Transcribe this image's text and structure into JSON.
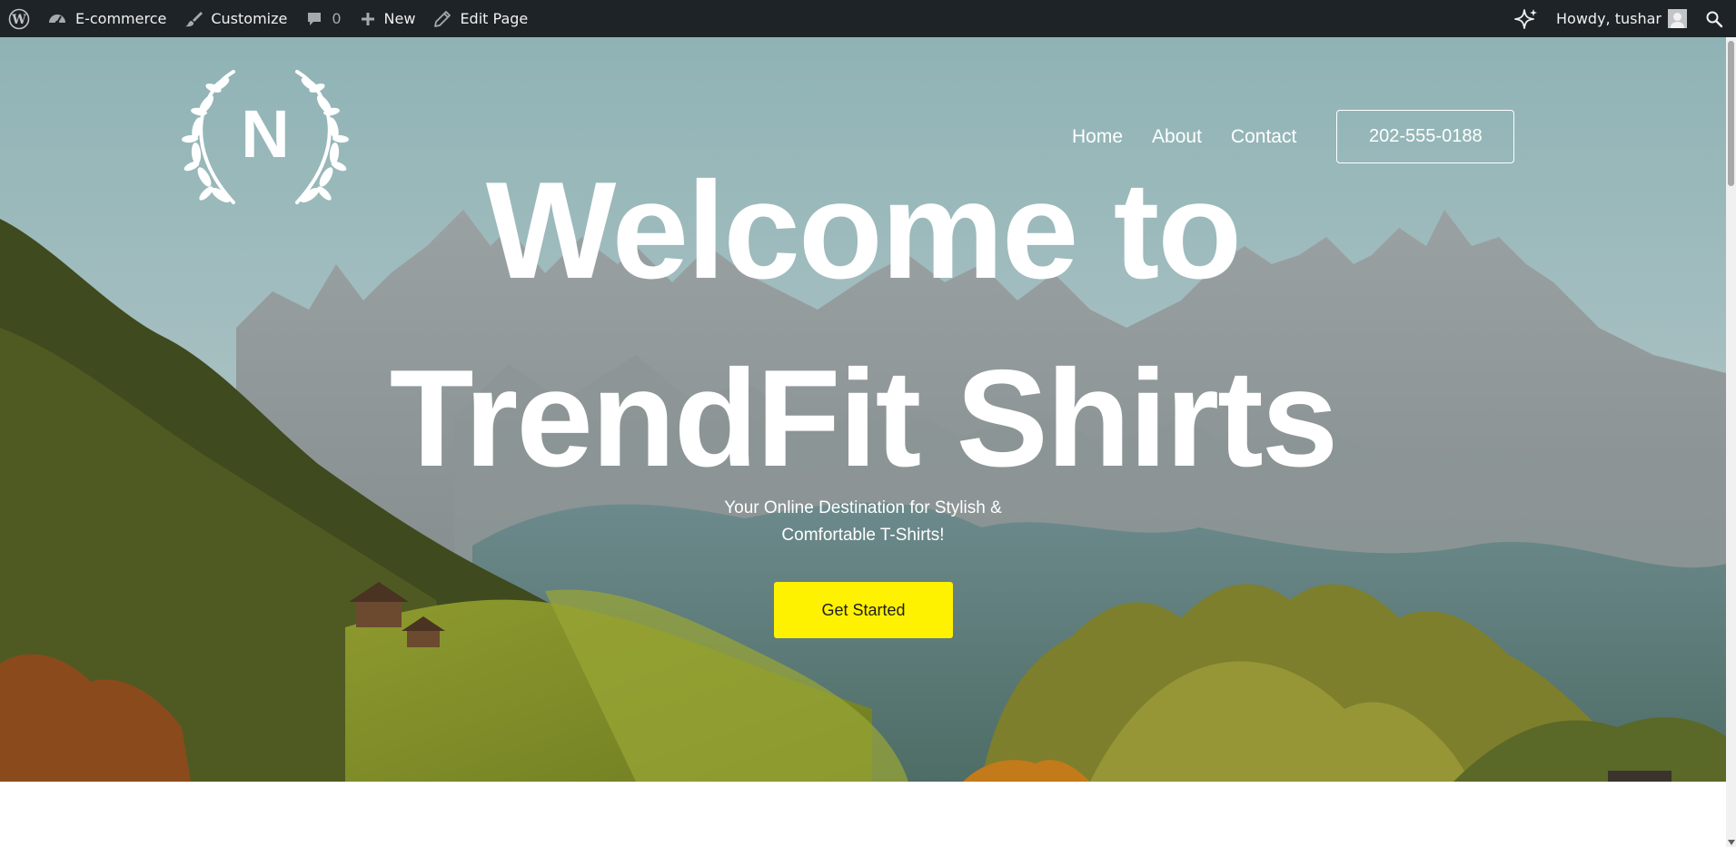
{
  "admin_bar": {
    "site_name": "E-commerce",
    "customize_label": "Customize",
    "comments_count": "0",
    "new_label": "New",
    "edit_page_label": "Edit Page",
    "howdy_label": "Howdy, tushar",
    "icons": [
      "wordpress-icon",
      "dashboard-icon",
      "brush-icon",
      "comment-icon",
      "plus-icon",
      "pencil-icon",
      "sparkle-icon",
      "avatar",
      "search-icon"
    ]
  },
  "header": {
    "logo_letter": "N",
    "nav": [
      {
        "label": "Home"
      },
      {
        "label": "About"
      },
      {
        "label": "Contact"
      }
    ],
    "phone_button_label": "202-555-0188"
  },
  "hero": {
    "title_line_1": "Welcome to",
    "title_line_2": "TrendFit Shirts",
    "subtitle_line_1": "Your Online Destination for Stylish &",
    "subtitle_line_2": "Comfortable T-Shirts!",
    "cta_label": "Get Started",
    "cta_color": "#fff200",
    "text_color": "#ffffff"
  },
  "colors": {
    "admin_bar_bg": "#1d2327",
    "admin_bar_text": "#f0f0f1"
  }
}
